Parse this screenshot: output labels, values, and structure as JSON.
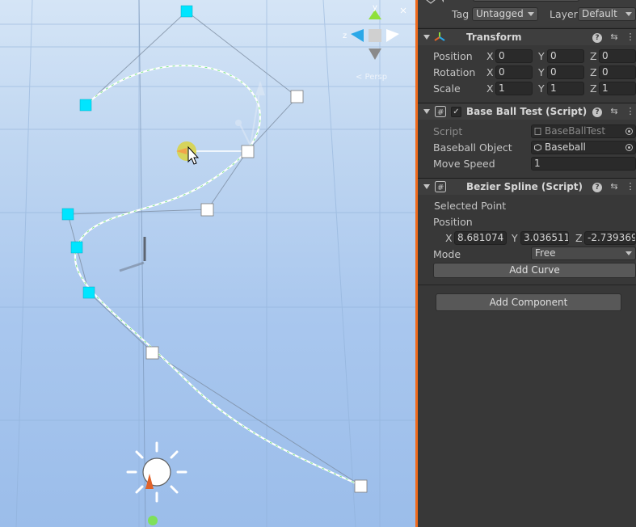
{
  "scene": {
    "view_label": "< Persp",
    "gizmo_axes": {
      "y": "y",
      "z": "z"
    }
  },
  "inspector": {
    "tag_label": "Tag",
    "tag_value": "Untagged",
    "layer_label": "Layer",
    "layer_value": "Default",
    "transform": {
      "title": "Transform",
      "position": {
        "label": "Position",
        "x": "0",
        "y": "0",
        "z": "0"
      },
      "rotation": {
        "label": "Rotation",
        "x": "0",
        "y": "0",
        "z": "0"
      },
      "scale": {
        "label": "Scale",
        "x": "1",
        "y": "1",
        "z": "1"
      }
    },
    "axis_labels": {
      "x": "X",
      "y": "Y",
      "z": "Z"
    },
    "baseball_test": {
      "title": "Base Ball Test (Script)",
      "enabled_mark": "✓",
      "script_label": "Script",
      "script_value": "BaseBallTest",
      "object_label": "Baseball Object",
      "object_value": "Baseball",
      "speed_label": "Move Speed",
      "speed_value": "1"
    },
    "bezier_spline": {
      "title": "Bezier Spline (Script)",
      "selected_point_label": "Selected Point",
      "position_label": "Position",
      "x": "8.681074",
      "y": "3.036511",
      "z": "-2.739369",
      "mode_label": "Mode",
      "mode_value": "Free",
      "add_curve_label": "Add Curve"
    },
    "add_component_label": "Add Component",
    "header_icons": {
      "help": "?",
      "preset": "⇆",
      "menu": "⋮"
    }
  }
}
